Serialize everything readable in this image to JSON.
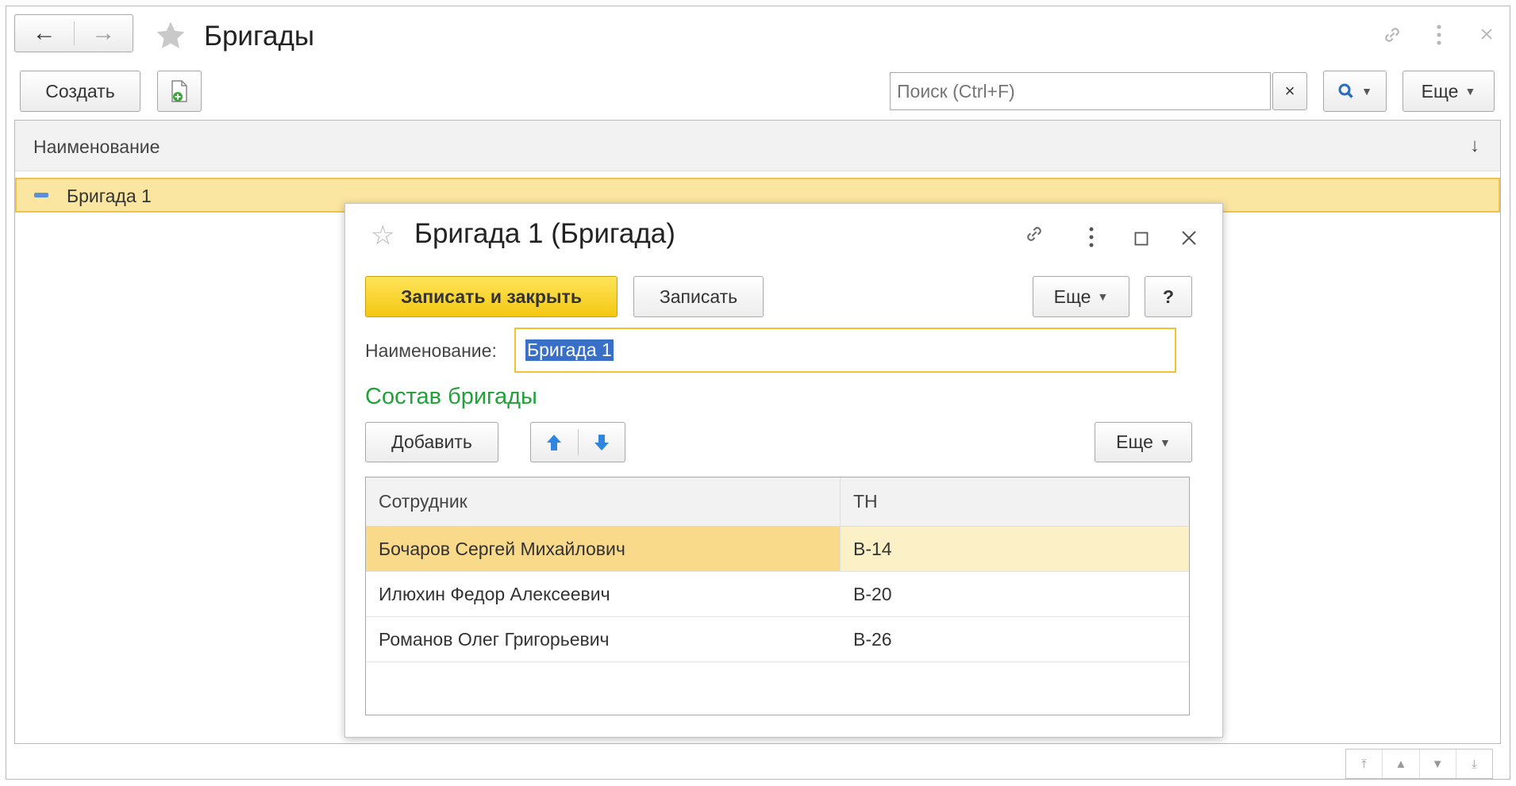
{
  "window": {
    "title": "Бригады",
    "nav_back": "←",
    "nav_forward": "→"
  },
  "toolbar": {
    "create_label": "Создать",
    "search_placeholder": "Поиск (Ctrl+F)",
    "search_clear": "×",
    "more_label": "Еще"
  },
  "list": {
    "column_header": "Наименование",
    "sort_indicator": "↓",
    "rows": [
      {
        "label": "Бригада 1"
      }
    ]
  },
  "dialog": {
    "title": "Бригада 1 (Бригада)",
    "save_close_label": "Записать и закрыть",
    "save_label": "Записать",
    "more_label": "Еще",
    "help_label": "?",
    "name_label": "Наименование:",
    "name_value": "Бригада 1",
    "section_title": "Состав бригады",
    "add_label": "Добавить",
    "table_more_label": "Еще",
    "table": {
      "headers": [
        "Сотрудник",
        "ТН"
      ],
      "rows": [
        {
          "employee": "Бочаров Сергей Михайлович",
          "tn": "В-14"
        },
        {
          "employee": "Илюхин Федор Алексеевич",
          "tn": "В-20"
        },
        {
          "employee": "Романов Олег Григорьевич",
          "tn": "В-26"
        }
      ]
    }
  },
  "colors": {
    "accent_yellow": "#f4c812",
    "selection": "#fae6a0",
    "section_green": "#22a03a",
    "text_selection": "#3a6fc7"
  }
}
